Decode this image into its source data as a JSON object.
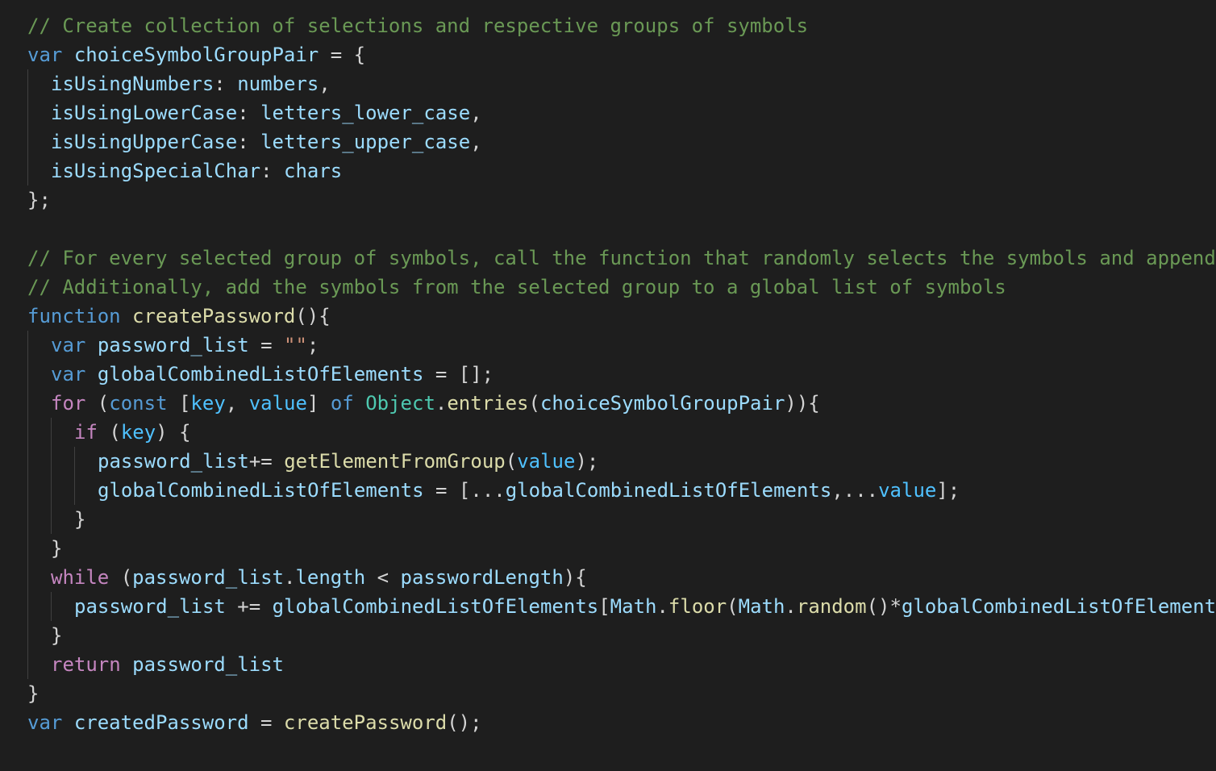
{
  "editor": {
    "theme": {
      "background": "#1e1e1e",
      "indent_guide": "#404040",
      "colors": {
        "comment": "#6a9955",
        "keyword": "#569cd6",
        "control": "#c586c0",
        "variable": "#9cdcfe",
        "function": "#dcdcaa",
        "class": "#4ec9b0",
        "string": "#ce9178",
        "constant": "#4fc1ff",
        "plain": "#d4d4d4"
      }
    },
    "lines": [
      {
        "indent": 0,
        "tokens": [
          {
            "t": "comment",
            "v": "// Create collection of selections and respective groups of symbols"
          }
        ]
      },
      {
        "indent": 0,
        "tokens": [
          {
            "t": "keyword",
            "v": "var"
          },
          {
            "t": "plain",
            "v": " "
          },
          {
            "t": "variable",
            "v": "choiceSymbolGroupPair"
          },
          {
            "t": "plain",
            "v": " = {"
          }
        ]
      },
      {
        "indent": 1,
        "tokens": [
          {
            "t": "variable",
            "v": "isUsingNumbers"
          },
          {
            "t": "plain",
            "v": ": "
          },
          {
            "t": "variable",
            "v": "numbers"
          },
          {
            "t": "plain",
            "v": ","
          }
        ]
      },
      {
        "indent": 1,
        "tokens": [
          {
            "t": "variable",
            "v": "isUsingLowerCase"
          },
          {
            "t": "plain",
            "v": ": "
          },
          {
            "t": "variable",
            "v": "letters_lower_case"
          },
          {
            "t": "plain",
            "v": ","
          }
        ]
      },
      {
        "indent": 1,
        "tokens": [
          {
            "t": "variable",
            "v": "isUsingUpperCase"
          },
          {
            "t": "plain",
            "v": ": "
          },
          {
            "t": "variable",
            "v": "letters_upper_case"
          },
          {
            "t": "plain",
            "v": ","
          }
        ]
      },
      {
        "indent": 1,
        "tokens": [
          {
            "t": "variable",
            "v": "isUsingSpecialChar"
          },
          {
            "t": "plain",
            "v": ": "
          },
          {
            "t": "variable",
            "v": "chars"
          }
        ]
      },
      {
        "indent": 0,
        "tokens": [
          {
            "t": "plain",
            "v": "};"
          }
        ]
      },
      {
        "indent": 0,
        "tokens": []
      },
      {
        "indent": 0,
        "tokens": [
          {
            "t": "comment",
            "v": "// For every selected group of symbols, call the function that randomly selects the symbols and append"
          }
        ]
      },
      {
        "indent": 0,
        "tokens": [
          {
            "t": "comment",
            "v": "// Additionally, add the symbols from the selected group to a global list of symbols"
          }
        ]
      },
      {
        "indent": 0,
        "tokens": [
          {
            "t": "keyword",
            "v": "function"
          },
          {
            "t": "plain",
            "v": " "
          },
          {
            "t": "function",
            "v": "createPassword"
          },
          {
            "t": "plain",
            "v": "(){"
          }
        ]
      },
      {
        "indent": 1,
        "tokens": [
          {
            "t": "keyword",
            "v": "var"
          },
          {
            "t": "plain",
            "v": " "
          },
          {
            "t": "variable",
            "v": "password_list"
          },
          {
            "t": "plain",
            "v": " = "
          },
          {
            "t": "string",
            "v": "\"\""
          },
          {
            "t": "plain",
            "v": ";"
          }
        ]
      },
      {
        "indent": 1,
        "tokens": [
          {
            "t": "keyword",
            "v": "var"
          },
          {
            "t": "plain",
            "v": " "
          },
          {
            "t": "variable",
            "v": "globalCombinedListOfElements"
          },
          {
            "t": "plain",
            "v": " = [];"
          }
        ]
      },
      {
        "indent": 1,
        "tokens": [
          {
            "t": "control",
            "v": "for"
          },
          {
            "t": "plain",
            "v": " ("
          },
          {
            "t": "keyword",
            "v": "const"
          },
          {
            "t": "plain",
            "v": " ["
          },
          {
            "t": "constant",
            "v": "key"
          },
          {
            "t": "plain",
            "v": ", "
          },
          {
            "t": "constant",
            "v": "value"
          },
          {
            "t": "plain",
            "v": "] "
          },
          {
            "t": "keyword",
            "v": "of"
          },
          {
            "t": "plain",
            "v": " "
          },
          {
            "t": "class",
            "v": "Object"
          },
          {
            "t": "plain",
            "v": "."
          },
          {
            "t": "function",
            "v": "entries"
          },
          {
            "t": "plain",
            "v": "("
          },
          {
            "t": "variable",
            "v": "choiceSymbolGroupPair"
          },
          {
            "t": "plain",
            "v": ")){"
          }
        ]
      },
      {
        "indent": 2,
        "tokens": [
          {
            "t": "control",
            "v": "if"
          },
          {
            "t": "plain",
            "v": " ("
          },
          {
            "t": "constant",
            "v": "key"
          },
          {
            "t": "plain",
            "v": ") {"
          }
        ]
      },
      {
        "indent": 3,
        "tokens": [
          {
            "t": "variable",
            "v": "password_list"
          },
          {
            "t": "plain",
            "v": "+= "
          },
          {
            "t": "function",
            "v": "getElementFromGroup"
          },
          {
            "t": "plain",
            "v": "("
          },
          {
            "t": "constant",
            "v": "value"
          },
          {
            "t": "plain",
            "v": ");"
          }
        ]
      },
      {
        "indent": 3,
        "tokens": [
          {
            "t": "variable",
            "v": "globalCombinedListOfElements"
          },
          {
            "t": "plain",
            "v": " = [..."
          },
          {
            "t": "variable",
            "v": "globalCombinedListOfElements"
          },
          {
            "t": "plain",
            "v": ",..."
          },
          {
            "t": "constant",
            "v": "value"
          },
          {
            "t": "plain",
            "v": "];"
          }
        ]
      },
      {
        "indent": 2,
        "tokens": [
          {
            "t": "plain",
            "v": "}"
          }
        ]
      },
      {
        "indent": 1,
        "tokens": [
          {
            "t": "plain",
            "v": "}"
          }
        ]
      },
      {
        "indent": 1,
        "tokens": [
          {
            "t": "control",
            "v": "while"
          },
          {
            "t": "plain",
            "v": " ("
          },
          {
            "t": "variable",
            "v": "password_list"
          },
          {
            "t": "plain",
            "v": "."
          },
          {
            "t": "variable",
            "v": "length"
          },
          {
            "t": "plain",
            "v": " < "
          },
          {
            "t": "variable",
            "v": "passwordLength"
          },
          {
            "t": "plain",
            "v": "){"
          }
        ]
      },
      {
        "indent": 2,
        "tokens": [
          {
            "t": "variable",
            "v": "password_list"
          },
          {
            "t": "plain",
            "v": " += "
          },
          {
            "t": "variable",
            "v": "globalCombinedListOfElements"
          },
          {
            "t": "plain",
            "v": "["
          },
          {
            "t": "variable",
            "v": "Math"
          },
          {
            "t": "plain",
            "v": "."
          },
          {
            "t": "function",
            "v": "floor"
          },
          {
            "t": "plain",
            "v": "("
          },
          {
            "t": "variable",
            "v": "Math"
          },
          {
            "t": "plain",
            "v": "."
          },
          {
            "t": "function",
            "v": "random"
          },
          {
            "t": "plain",
            "v": "()*"
          },
          {
            "t": "variable",
            "v": "globalCombinedListOfElement"
          }
        ]
      },
      {
        "indent": 1,
        "tokens": [
          {
            "t": "plain",
            "v": "}"
          }
        ]
      },
      {
        "indent": 1,
        "tokens": [
          {
            "t": "control",
            "v": "return"
          },
          {
            "t": "plain",
            "v": " "
          },
          {
            "t": "variable",
            "v": "password_list"
          }
        ]
      },
      {
        "indent": 0,
        "tokens": [
          {
            "t": "plain",
            "v": "}"
          }
        ]
      },
      {
        "indent": 0,
        "tokens": [
          {
            "t": "keyword",
            "v": "var"
          },
          {
            "t": "plain",
            "v": " "
          },
          {
            "t": "variable",
            "v": "createdPassword"
          },
          {
            "t": "plain",
            "v": " = "
          },
          {
            "t": "function",
            "v": "createPassword"
          },
          {
            "t": "plain",
            "v": "();"
          }
        ]
      }
    ]
  }
}
